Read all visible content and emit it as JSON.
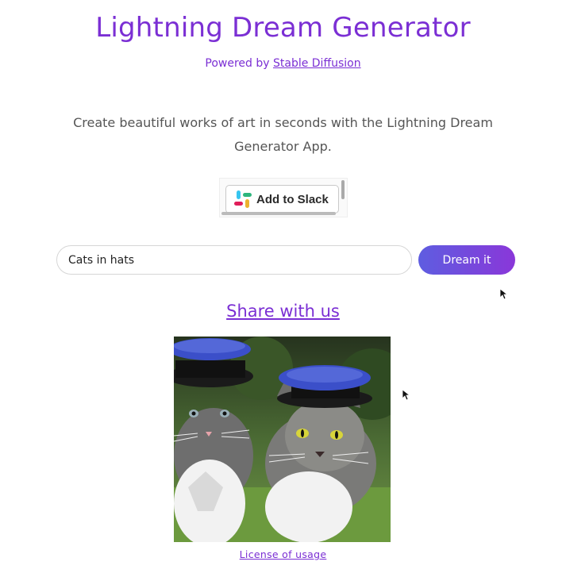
{
  "header": {
    "title": "Lightning Dream Generator",
    "powered_prefix": "Powered by ",
    "powered_link": "Stable Diffusion"
  },
  "description": "Create beautiful works of art in seconds with the Lightning Dream Generator App.",
  "slack": {
    "label": "Add to Slack",
    "icon": "slack-logo-icon"
  },
  "prompt": {
    "value": "Cats in hats",
    "placeholder": ""
  },
  "dream_button": "Dream it",
  "share_link": "Share with us",
  "result_image": {
    "subject": "cats wearing blue hats",
    "alt": ""
  },
  "license_link": "License of usage",
  "colors": {
    "accent": "#7b2fd4",
    "button_gradient_start": "#5e5de0",
    "button_gradient_end": "#8a37d9",
    "text": "#555555"
  }
}
